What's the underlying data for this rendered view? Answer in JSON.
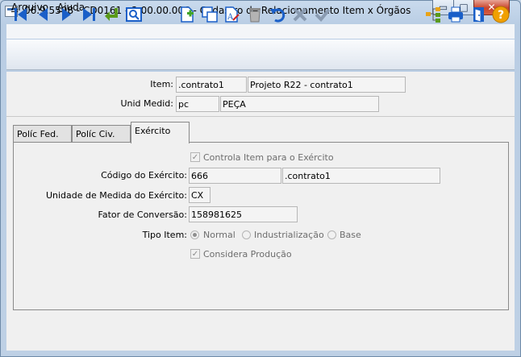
{
  "window": {
    "title": "06.9.5508 - CD0161 - 2.00.00.006 - Cadastro de Relacionamento Item x Órgãos",
    "minimize_glyph": "▭",
    "maximize_glyph": "□",
    "close_glyph": "✕"
  },
  "menu": {
    "items": [
      {
        "label": "Arquivo",
        "accelerator": "A"
      },
      {
        "label": "Ajuda",
        "accelerator": "A"
      }
    ]
  },
  "toolbar": {
    "icons": [
      "first-record-icon",
      "previous-record-icon",
      "next-record-icon",
      "last-record-icon",
      "goto-icon",
      "search-icon",
      "new-record-icon",
      "copy-icon",
      "edit-icon",
      "delete-icon",
      "undo-icon",
      "cancel-icon",
      "confirm-icon",
      "relations-icon",
      "print-icon",
      "exit-icon",
      "help-icon"
    ],
    "accent": "#1a5fc8"
  },
  "header": {
    "item_label": "Item:",
    "item_code": ".contrato1",
    "item_desc": "Projeto R22 - contrato1",
    "unid_label": "Unid Medid:",
    "unid_code": "pc",
    "unid_desc": "PEÇA"
  },
  "tabs": [
    {
      "label": "Políc Fed.",
      "active": false
    },
    {
      "label": "Políc Civ.",
      "active": false
    },
    {
      "label": "Exército",
      "active": true
    }
  ],
  "exercito": {
    "controla_item_label": "Controla Item para o Exército",
    "controla_item_checked": true,
    "codigo_label": "Código do Exército:",
    "codigo_value": "666",
    "codigo_desc": ".contrato1",
    "unidade_label": "Unidade de Medida do Exército:",
    "unidade_value": "CX",
    "fator_label": "Fator de Conversão:",
    "fator_value": "158981625",
    "tipo_item_label": "Tipo Item:",
    "tipo_options": [
      {
        "label": "Normal",
        "selected": true
      },
      {
        "label": "Industrialização",
        "selected": false
      },
      {
        "label": "Base",
        "selected": false
      }
    ],
    "considera_producao_label": "Considera Produção",
    "considera_producao_checked": true
  }
}
